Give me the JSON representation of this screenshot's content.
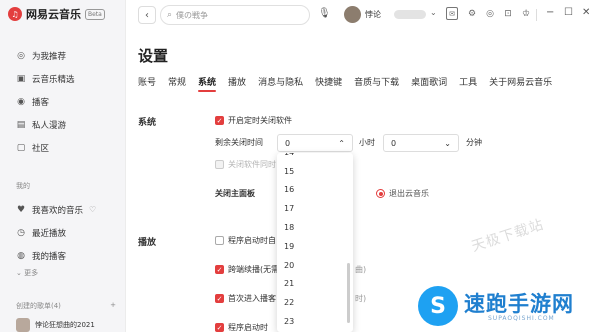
{
  "app": {
    "name": "网易云音乐",
    "badge": "Beta",
    "logo_icon": "netease-logo-icon"
  },
  "sidebar": {
    "nav": [
      {
        "label": "为我推荐",
        "icon": "recommend-icon"
      },
      {
        "label": "云音乐精选",
        "icon": "selection-icon"
      },
      {
        "label": "播客",
        "icon": "podcast-icon"
      },
      {
        "label": "私人漫游",
        "icon": "radio-icon"
      },
      {
        "label": "社区",
        "icon": "community-icon"
      }
    ],
    "mine_label": "我的",
    "mine": [
      {
        "label": "我喜欢的音乐",
        "icon": "heart-icon"
      },
      {
        "label": "最近播放",
        "icon": "clock-icon"
      },
      {
        "label": "我的播客",
        "icon": "mic-icon"
      }
    ],
    "more": "更多",
    "created_label": "创建的歌单(4)",
    "created_add": "+",
    "playlist_name": "悖论狂想曲的2021"
  },
  "topbar": {
    "back": "‹",
    "search_placeholder": "僕の戦争",
    "username": "悖论",
    "user_chevron": "⌄",
    "minimize": "−",
    "maximize": "☐",
    "close": "✕"
  },
  "page": {
    "title": "设置"
  },
  "tabs": [
    "账号",
    "常规",
    "系统",
    "播放",
    "消息与隐私",
    "快捷键",
    "音质与下载",
    "桌面歌词",
    "工具",
    "关于网易云音乐"
  ],
  "active_tab": "系统",
  "system": {
    "label": "系统",
    "timed_close_label": "开启定时关闭软件",
    "remaining_label": "剩余关闭时间",
    "hours_value": "0",
    "hours_unit": "小时",
    "minutes_value": "0",
    "minutes_unit": "分钟",
    "close_after_label": "关闭软件同时",
    "close_panel_label": "关闭主面板",
    "exit_option_label": "退出云音乐",
    "dropdown_options": [
      "14",
      "15",
      "16",
      "17",
      "18",
      "19",
      "20",
      "21",
      "22",
      "23"
    ]
  },
  "playback": {
    "label": "播放",
    "items": [
      {
        "label": "程序启动时自",
        "checked": false,
        "suffix": ""
      },
      {
        "label": "跨端续播(无需",
        "checked": true,
        "suffix": "曲)"
      },
      {
        "label": "首次进入播客",
        "checked": true,
        "suffix": "时)"
      },
      {
        "label": "程序启动时",
        "checked": true,
        "suffix": ""
      }
    ]
  },
  "watermark": {
    "text": "天极下载站",
    "brand": "速跑手游网",
    "url": "SUPAOQISHI.COM",
    "brand_badge": "S"
  },
  "colors": {
    "accent": "#e33e3e",
    "brand_blue": "#1f7fcf"
  }
}
